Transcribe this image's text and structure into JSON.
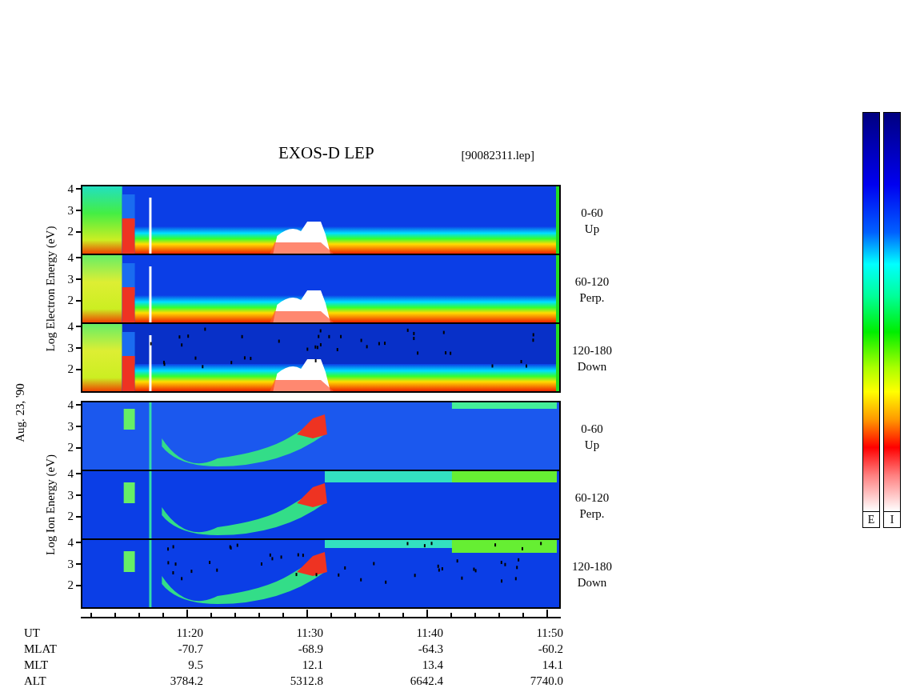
{
  "title": "EXOS-D LEP",
  "file_tag": "[90082311.lep]",
  "date_label": "Aug. 23, '90",
  "groups": [
    {
      "kind": "electron",
      "axis_label": "Log Electron Energy (eV)",
      "panels": [
        {
          "range": "0-60",
          "direction": "Up",
          "ticks": [
            "4",
            "3",
            "2"
          ]
        },
        {
          "range": "60-120",
          "direction": "Perp.",
          "ticks": [
            "4",
            "3",
            "2"
          ]
        },
        {
          "range": "120-180",
          "direction": "Down",
          "ticks": [
            "4",
            "3",
            "2"
          ]
        }
      ]
    },
    {
      "kind": "ion",
      "axis_label": "Log Ion Energy (eV)",
      "panels": [
        {
          "range": "0-60",
          "direction": "Up",
          "ticks": [
            "4",
            "3",
            "2"
          ]
        },
        {
          "range": "60-120",
          "direction": "Perp.",
          "ticks": [
            "4",
            "3",
            "2"
          ]
        },
        {
          "range": "120-180",
          "direction": "Down",
          "ticks": [
            "4",
            "3",
            "2"
          ]
        }
      ]
    }
  ],
  "time_rows": [
    {
      "label": "UT",
      "values": [
        "11:20",
        "11:30",
        "11:40",
        "11:50"
      ]
    },
    {
      "label": "MLAT",
      "values": [
        "-70.7",
        "-68.9",
        "-64.3",
        "-60.2"
      ]
    },
    {
      "label": "MLT",
      "values": [
        "9.5",
        "12.1",
        "13.4",
        "14.1"
      ]
    },
    {
      "label": "ALT",
      "values": [
        "3784.2",
        "5312.8",
        "6642.4",
        "7740.0"
      ]
    }
  ],
  "color_bars": [
    {
      "label": "E"
    },
    {
      "label": "I"
    }
  ]
}
